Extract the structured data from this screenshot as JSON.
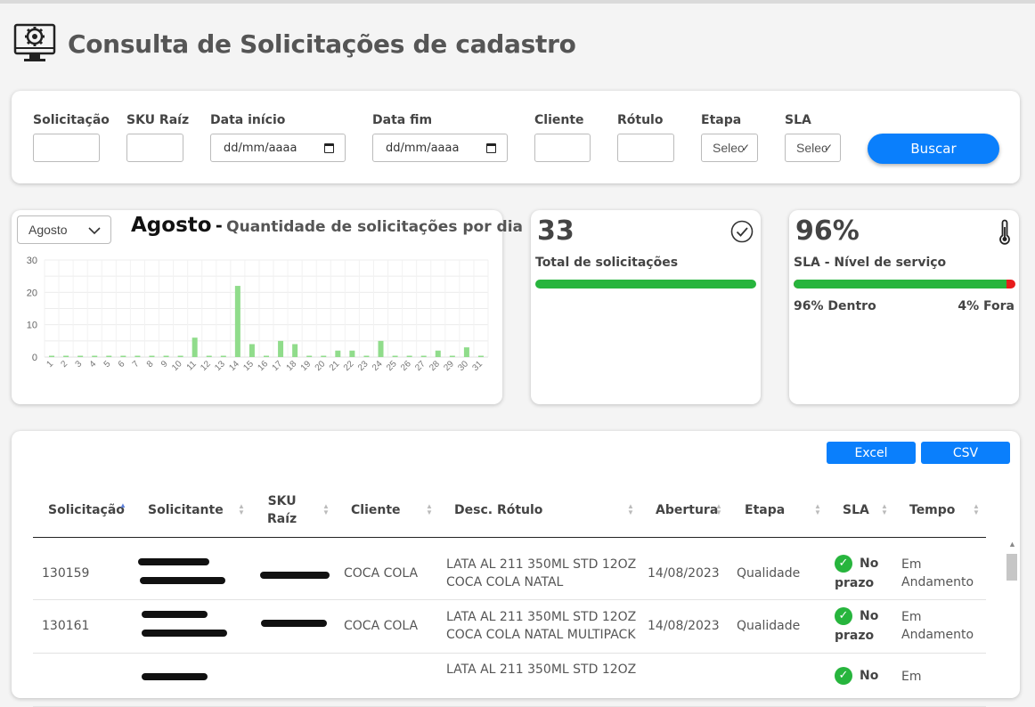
{
  "page": {
    "title": "Consulta de Solicitações de cadastro"
  },
  "filters": {
    "solicitacao_label": "Solicitação",
    "sku_label": "SKU Raíz",
    "data_inicio_label": "Data início",
    "data_inicio_value": "dd/mm/aaaa",
    "data_fim_label": "Data fim",
    "data_fim_value": "dd/mm/aaaa",
    "cliente_label": "Cliente",
    "rotulo_label": "Rótulo",
    "etapa_label": "Etapa",
    "etapa_value": "Selecione",
    "sla_label": "SLA",
    "sla_value": "Selecione",
    "buscar_label": "Buscar"
  },
  "chart_panel": {
    "month_select": "Agosto",
    "title_month": "Agosto",
    "title_sep": "-",
    "title_rest": "Quantidade de solicitações por dia"
  },
  "chart_data": {
    "type": "bar",
    "title": "Agosto - Quantidade de solicitações por dia",
    "categories": [
      "1",
      "2",
      "3",
      "4",
      "5",
      "6",
      "7",
      "8",
      "9",
      "10",
      "11",
      "12",
      "13",
      "14",
      "15",
      "16",
      "17",
      "18",
      "19",
      "20",
      "21",
      "22",
      "23",
      "24",
      "25",
      "26",
      "27",
      "28",
      "29",
      "30",
      "31"
    ],
    "values": [
      0,
      0,
      0,
      0,
      0,
      0,
      0,
      0,
      0,
      0,
      6,
      0,
      0,
      22,
      4,
      0,
      5,
      4,
      0,
      0,
      2,
      2,
      0,
      5,
      0,
      0,
      0,
      2,
      0,
      3,
      0
    ],
    "ylim": [
      0,
      30
    ],
    "yticks": [
      0,
      10,
      20,
      30
    ],
    "grid": true,
    "color": "#90dc8b"
  },
  "kpi_total": {
    "value": "33",
    "label": "Total de solicitações",
    "fill_fraction": 1.0,
    "icon": "check-circle-icon"
  },
  "kpi_sla": {
    "value": "96%",
    "label": "SLA - Nível de serviço",
    "inside_fraction": 0.96,
    "inside_label": "96% Dentro",
    "outside_label": "4% Fora",
    "icon": "thermometer-icon"
  },
  "table": {
    "excel_label": "Excel",
    "csv_label": "CSV",
    "columns": {
      "solicitacao": "Solicitação",
      "solicitante": "Solicitante",
      "sku_line1": "SKU",
      "sku_line2": "Raíz",
      "cliente": "Cliente",
      "desc_rotulo": "Desc. Rótulo",
      "abertura": "Abertura",
      "etapa": "Etapa",
      "sla": "SLA",
      "tempo": "Tempo"
    },
    "rows": [
      {
        "solicitacao": "130159",
        "cliente": "COCA COLA",
        "desc_line1": "LATA AL 211 350ML STD 12OZ",
        "desc_line2": "COCA COLA NATAL",
        "abertura": "14/08/2023",
        "etapa": "Qualidade",
        "sla_line1": "No",
        "sla_line2": "prazo",
        "tempo_line1": "Em",
        "tempo_line2": "Andamento"
      },
      {
        "solicitacao": "130161",
        "cliente": "COCA COLA",
        "desc_line1": "LATA AL 211 350ML STD 12OZ",
        "desc_line2": "COCA COLA NATAL MULTIPACK",
        "abertura": "14/08/2023",
        "etapa": "Qualidade",
        "sla_line1": "No",
        "sla_line2": "prazo",
        "tempo_line1": "Em",
        "tempo_line2": "Andamento"
      },
      {
        "desc_line1": "LATA AL 211 350ML STD 12OZ",
        "sla_line1": "No",
        "tempo_line1": "Em"
      }
    ]
  }
}
